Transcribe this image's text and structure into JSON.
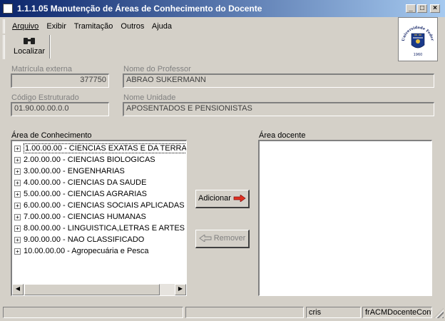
{
  "window": {
    "title": "1.1.1.05 Manutenção de Áreas de Conhecimento do Docente",
    "minimize": "_",
    "maximize": "□",
    "close": "×"
  },
  "menu": [
    {
      "label": "Arquivo"
    },
    {
      "label": "Exibir"
    },
    {
      "label": "Tramitação"
    },
    {
      "label": "Outros"
    },
    {
      "label": "Ajuda"
    }
  ],
  "toolbar": {
    "localizar_label": "Localizar",
    "localizar_icon": "binoculars-icon"
  },
  "logo": {
    "text": "Universidade Federal de Santa Maria",
    "year": "1960"
  },
  "form": {
    "matricula_label": "Matrícula externa",
    "matricula_value": "377750",
    "professor_label": "Nome do Professor",
    "professor_value": "ABRAO SUKERMANN",
    "codigo_label": "Código Estruturado",
    "codigo_value": "01.90.00.00.0.0",
    "unidade_label": "Nome Unidade",
    "unidade_value": "APOSENTADOS E PENSIONISTAS"
  },
  "areas": {
    "label": "Área de Conhecimento",
    "items": [
      {
        "label": "1.00.00.00 - CIENCIAS EXATAS E DA TERRA"
      },
      {
        "label": "2.00.00.00 - CIENCIAS BIOLOGICAS"
      },
      {
        "label": "3.00.00.00 - ENGENHARIAS"
      },
      {
        "label": "4.00.00.00 - CIENCIAS DA SAUDE"
      },
      {
        "label": "5.00.00.00 - CIENCIAS AGRARIAS"
      },
      {
        "label": "6.00.00.00 - CIENCIAS SOCIAIS APLICADAS"
      },
      {
        "label": "7.00.00.00 - CIENCIAS HUMANAS"
      },
      {
        "label": "8.00.00.00 - LINGUISTICA,LETRAS E ARTES"
      },
      {
        "label": "9.00.00.00 - NAO CLASSIFICADO"
      },
      {
        "label": "10.00.00.00 - Agropecuária e Pesca"
      }
    ]
  },
  "docente": {
    "label": "Área docente"
  },
  "buttons": {
    "adicionar": "Adicionar",
    "remover": "Remover"
  },
  "status": {
    "user": "cris",
    "form_name": "frACMDocenteConf"
  },
  "colors": {
    "title_start": "#0a246a",
    "title_end": "#a6caf0",
    "face": "#d4d0c8",
    "arrow": "#e03020"
  }
}
